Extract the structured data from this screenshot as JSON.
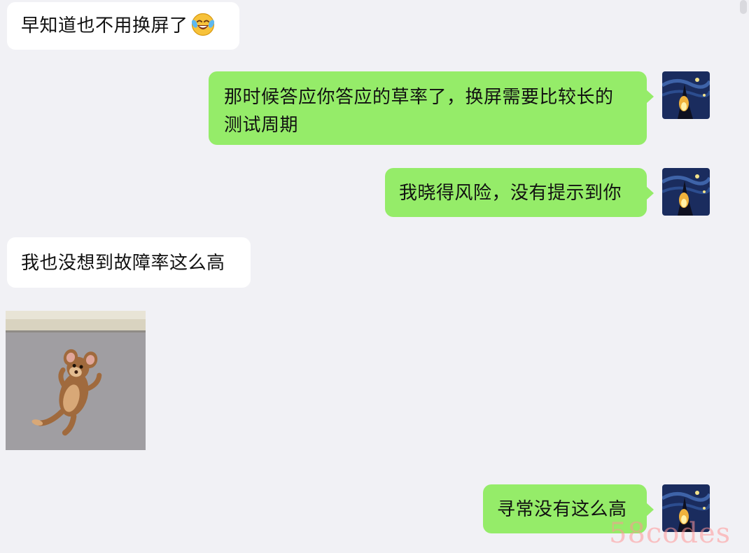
{
  "messages": [
    {
      "side": "left",
      "text": "早知道也不用换屏了",
      "emoji": "laughing-tears-emoji"
    },
    {
      "side": "right",
      "line1": "那时候答应你答应的草率了，换屏需要比较长的",
      "line2": "测试周期"
    },
    {
      "side": "right",
      "text": "我晓得风险，没有提示到你"
    },
    {
      "side": "left",
      "text": "我也没想到故障率这么高"
    },
    {
      "side": "left",
      "sticker": "jerry-mouse-sticker"
    },
    {
      "side": "right",
      "text": "寻常没有这么高"
    }
  ],
  "watermark": "58codes",
  "colors": {
    "background": "#f1f1f5",
    "incoming_bubble": "#ffffff",
    "outgoing_bubble": "#95ec69",
    "text": "#111111"
  }
}
